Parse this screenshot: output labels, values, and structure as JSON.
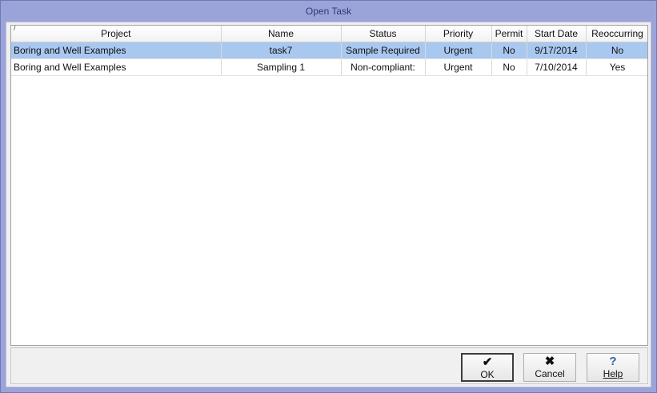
{
  "window": {
    "title": "Open Task"
  },
  "table": {
    "sort_indicator": "/",
    "columns": [
      "Project",
      "Name",
      "Status",
      "Priority",
      "Permit",
      "Start Date",
      "Reoccurring"
    ],
    "rows": [
      [
        "Boring and Well Examples",
        "task7",
        "Sample Required",
        "Urgent",
        "No",
        "9/17/2014",
        "No"
      ],
      [
        "Boring and Well Examples",
        "Sampling 1",
        "Non-compliant:",
        "Urgent",
        "No",
        "7/10/2014",
        "Yes"
      ]
    ],
    "selected_row": 0,
    "selection_color": "#a9c8f0"
  },
  "buttons": {
    "ok": {
      "label": "OK",
      "icon": "checkmark-icon",
      "glyph": "✔"
    },
    "cancel": {
      "label": "Cancel",
      "icon": "x-icon",
      "glyph": "✖"
    },
    "help": {
      "label": "Help",
      "icon": "question-icon",
      "glyph": "?"
    }
  }
}
